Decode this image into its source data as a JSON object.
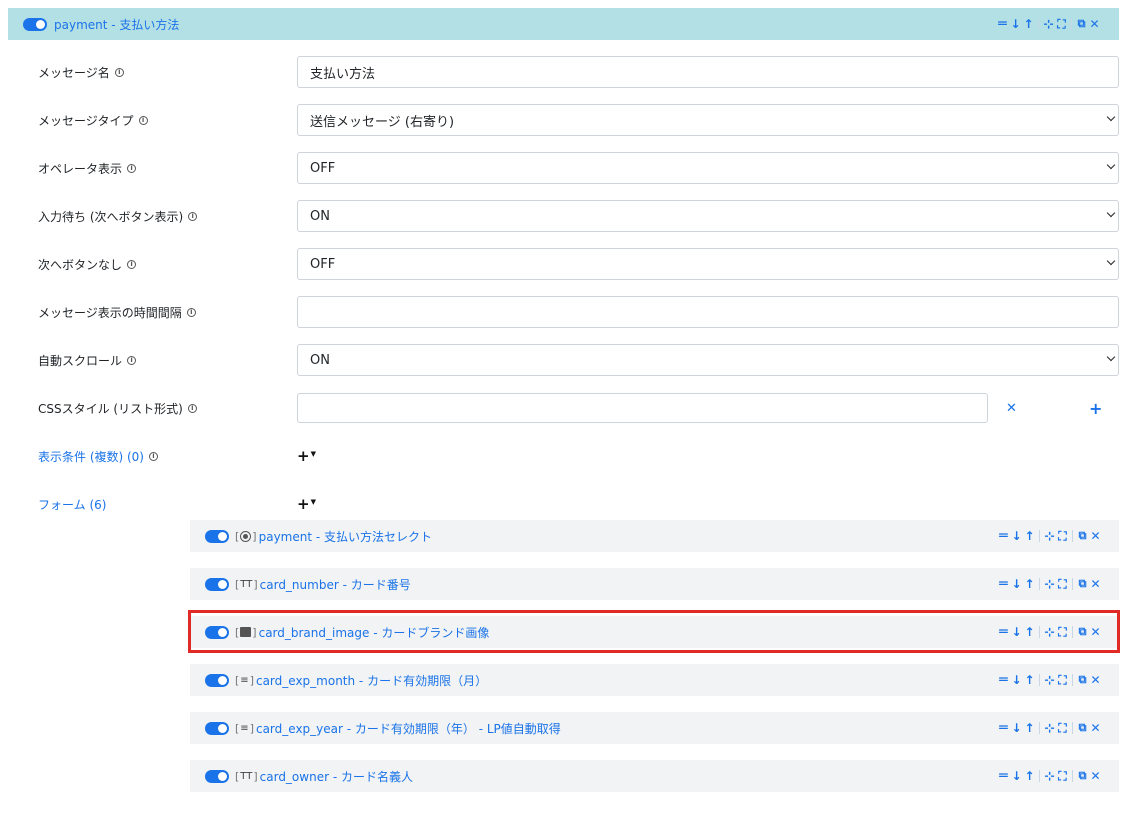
{
  "header": {
    "title": "payment - 支払い方法",
    "tools": [
      "reorder-icon",
      "arrow-down-icon",
      "arrow-up-icon",
      "compress-icon",
      "expand-icon",
      "copy-icon",
      "close-icon"
    ]
  },
  "fields": {
    "message_name": {
      "label": "メッセージ名",
      "value": "支払い方法"
    },
    "message_type": {
      "label": "メッセージタイプ",
      "value": "送信メッセージ (右寄り)"
    },
    "operator_display": {
      "label": "オペレータ表示",
      "value": "OFF"
    },
    "input_wait": {
      "label": "入力待ち (次へボタン表示)",
      "value": "ON"
    },
    "no_next_button": {
      "label": "次へボタンなし",
      "value": "OFF"
    },
    "display_interval": {
      "label": "メッセージ表示の時間間隔",
      "value": ""
    },
    "auto_scroll": {
      "label": "自動スクロール",
      "value": "ON"
    },
    "css_style": {
      "label": "CSSスタイル (リスト形式)",
      "value": ""
    }
  },
  "conditions": {
    "label": "表示条件 (複数) (0)"
  },
  "forms": {
    "label": "フォーム (6)",
    "items": [
      {
        "type_icon": "radio-icon",
        "title": "payment - 支払い方法セレクト"
      },
      {
        "type_icon": "text-icon",
        "type_text": "TT",
        "title": "card_number - カード番号"
      },
      {
        "type_icon": "image-icon",
        "title": "card_brand_image - カードブランド画像",
        "highlighted": true
      },
      {
        "type_icon": "list-icon",
        "type_text": "≡",
        "title": "card_exp_month - カード有効期限（月）"
      },
      {
        "type_icon": "list-icon",
        "type_text": "≡",
        "title": "card_exp_year - カード有効期限（年） - LP値自動取得"
      },
      {
        "type_icon": "text-icon",
        "type_text": "TT",
        "title": "card_owner - カード名義人"
      }
    ]
  },
  "colors": {
    "accent": "#1a73e8",
    "header_bg": "#b3e0e5",
    "highlight": "#e02a25"
  }
}
